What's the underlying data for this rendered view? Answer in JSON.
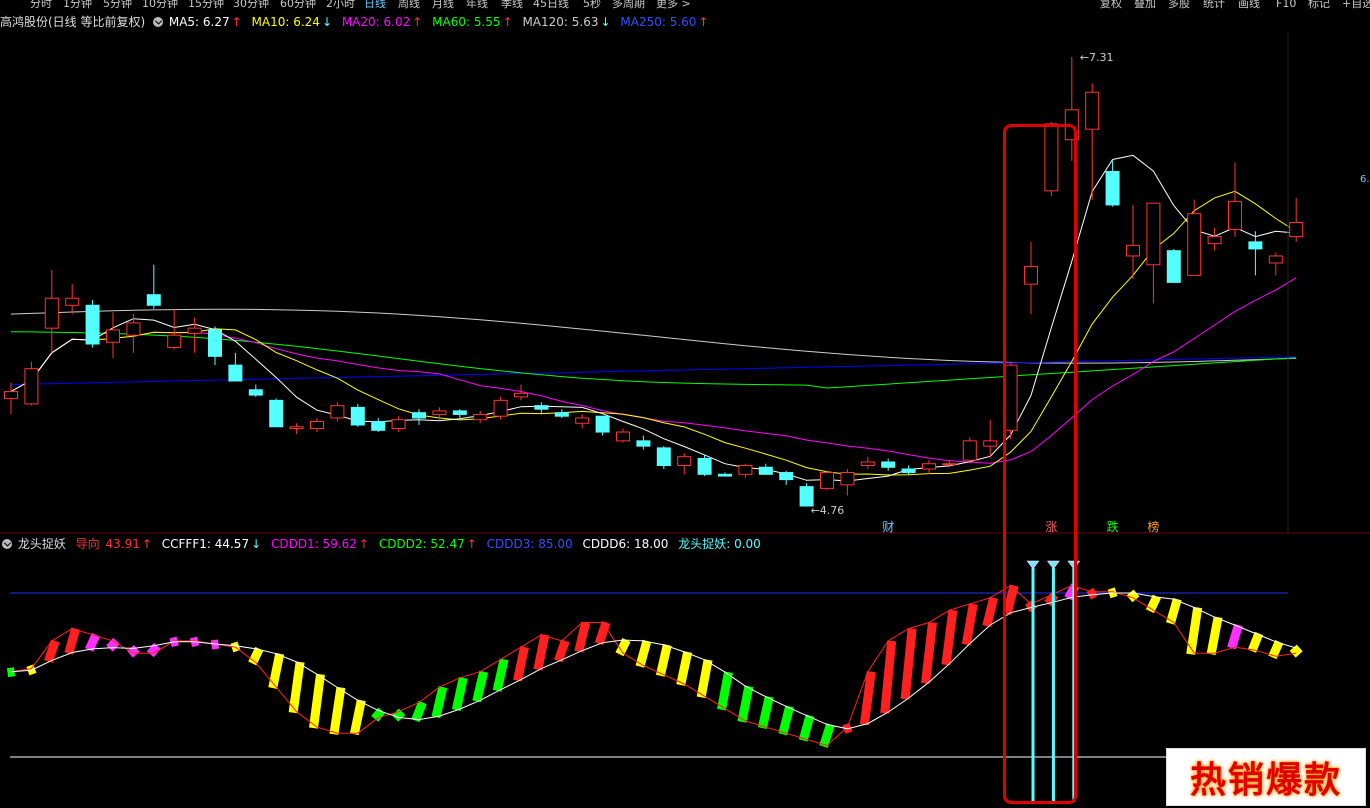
{
  "toolbar": {
    "timeframes": [
      "分时",
      "1分钟",
      "5分钟",
      "10分钟",
      "15分钟",
      "30分钟",
      "60分钟",
      "2小时",
      "日线",
      "周线",
      "月线",
      "年线",
      "季线",
      "45日线",
      "5秒",
      "多周期",
      "更多 >"
    ],
    "active_timeframe": "日线",
    "right_actions": [
      "复权",
      "叠加",
      "多股",
      "统计",
      "画线",
      "F10",
      "标记",
      "+自选"
    ]
  },
  "main_header": {
    "stock_label": "高鸿股份(日线 等比前复权)",
    "ma5": "MA5: 6.27",
    "ma10": "MA10: 6.24",
    "ma20": "MA20: 6.02",
    "ma60": "MA60: 5.55",
    "ma120": "MA120: 5.63",
    "ma250": "MA250: 5.60",
    "ma5_trend": "↑",
    "ma10_trend": "↓",
    "ma20_trend": "↑",
    "ma60_trend": "↑",
    "ma120_trend": "↓",
    "ma250_trend": "↑"
  },
  "price_labels": {
    "high": "7.31",
    "low": "4.76",
    "right_edge": "6."
  },
  "event_markers": {
    "cai": "财",
    "zhang": "涨",
    "die": "跌",
    "bang": "榜"
  },
  "indicator_header": {
    "name": "龙头捉妖",
    "daoxiang": "导向",
    "daoxiang_val": "43.91",
    "ccfff1": "CCFFF1: 44.57",
    "cddd1": "CDDD1: 59.62",
    "cddd2": "CDDD2: 52.47",
    "cddd3": "CDDD3: 85.00",
    "cddd6": "CDDD6: 18.00",
    "ltzy": "龙头捉妖: 0.00",
    "daoxiang_trend": "↑",
    "ccfff1_trend": "↓",
    "cddd1_trend": "↑",
    "cddd2_trend": "↑"
  },
  "watermark": {
    "text": "热销爆款"
  },
  "colors": {
    "up": "#ff3232",
    "down": "#54ffff",
    "ma5": "#ffffff",
    "ma10": "#ffff00",
    "ma20": "#ff00ff",
    "ma60": "#00ff00",
    "ma120": "#cccccc",
    "ma250": "#0000ff",
    "highlight_box": "#e00000"
  },
  "candles": [
    {
      "o": 5.37,
      "c": 5.41,
      "h": 5.46,
      "l": 5.28
    },
    {
      "o": 5.34,
      "c": 5.54,
      "h": 5.58,
      "l": 5.33
    },
    {
      "o": 5.77,
      "c": 5.94,
      "h": 6.1,
      "l": 5.63
    },
    {
      "o": 5.9,
      "c": 5.94,
      "h": 6.02,
      "l": 5.85
    },
    {
      "o": 5.9,
      "c": 5.68,
      "h": 5.93,
      "l": 5.66
    },
    {
      "o": 5.69,
      "c": 5.76,
      "h": 5.86,
      "l": 5.6
    },
    {
      "o": 5.73,
      "c": 5.8,
      "h": 5.85,
      "l": 5.63
    },
    {
      "o": 5.96,
      "c": 5.9,
      "h": 6.13,
      "l": 5.88
    },
    {
      "o": 5.66,
      "c": 5.73,
      "h": 5.88,
      "l": 5.65
    },
    {
      "o": 5.74,
      "c": 5.77,
      "h": 5.83,
      "l": 5.63
    },
    {
      "o": 5.76,
      "c": 5.61,
      "h": 5.78,
      "l": 5.56
    },
    {
      "o": 5.56,
      "c": 5.47,
      "h": 5.63,
      "l": 5.47
    },
    {
      "o": 5.42,
      "c": 5.39,
      "h": 5.45,
      "l": 5.38
    },
    {
      "o": 5.36,
      "c": 5.21,
      "h": 5.37,
      "l": 5.21
    },
    {
      "o": 5.2,
      "c": 5.21,
      "h": 5.23,
      "l": 5.17
    },
    {
      "o": 5.2,
      "c": 5.24,
      "h": 5.26,
      "l": 5.18
    },
    {
      "o": 5.26,
      "c": 5.33,
      "h": 5.35,
      "l": 5.24
    },
    {
      "o": 5.32,
      "c": 5.22,
      "h": 5.34,
      "l": 5.21
    },
    {
      "o": 5.24,
      "c": 5.19,
      "h": 5.26,
      "l": 5.18
    },
    {
      "o": 5.2,
      "c": 5.25,
      "h": 5.27,
      "l": 5.18
    },
    {
      "o": 5.29,
      "c": 5.26,
      "h": 5.31,
      "l": 5.22
    },
    {
      "o": 5.28,
      "c": 5.3,
      "h": 5.32,
      "l": 5.25
    },
    {
      "o": 5.3,
      "c": 5.28,
      "h": 5.31,
      "l": 5.26
    },
    {
      "o": 5.25,
      "c": 5.28,
      "h": 5.3,
      "l": 5.23
    },
    {
      "o": 5.27,
      "c": 5.36,
      "h": 5.38,
      "l": 5.25
    },
    {
      "o": 5.38,
      "c": 5.4,
      "h": 5.45,
      "l": 5.36
    },
    {
      "o": 5.33,
      "c": 5.31,
      "h": 5.35,
      "l": 5.28
    },
    {
      "o": 5.29,
      "c": 5.27,
      "h": 5.31,
      "l": 5.26
    },
    {
      "o": 5.23,
      "c": 5.26,
      "h": 5.28,
      "l": 5.2
    },
    {
      "o": 5.27,
      "c": 5.18,
      "h": 5.27,
      "l": 5.16
    },
    {
      "o": 5.13,
      "c": 5.18,
      "h": 5.2,
      "l": 5.12
    },
    {
      "o": 5.13,
      "c": 5.1,
      "h": 5.16,
      "l": 5.08
    },
    {
      "o": 5.09,
      "c": 4.99,
      "h": 5.1,
      "l": 4.97
    },
    {
      "o": 4.99,
      "c": 5.04,
      "h": 5.06,
      "l": 4.94
    },
    {
      "o": 5.03,
      "c": 4.94,
      "h": 5.05,
      "l": 4.93
    },
    {
      "o": 4.94,
      "c": 4.93,
      "h": 4.95,
      "l": 4.93
    },
    {
      "o": 4.94,
      "c": 4.99,
      "h": 5.0,
      "l": 4.92
    },
    {
      "o": 4.98,
      "c": 4.94,
      "h": 5.0,
      "l": 4.94
    },
    {
      "o": 4.95,
      "c": 4.91,
      "h": 4.96,
      "l": 4.88
    },
    {
      "o": 4.87,
      "c": 4.76,
      "h": 4.89,
      "l": 4.76
    },
    {
      "o": 4.86,
      "c": 4.95,
      "h": 4.96,
      "l": 4.85
    },
    {
      "o": 4.88,
      "c": 4.95,
      "h": 4.97,
      "l": 4.82
    },
    {
      "o": 4.99,
      "c": 5.01,
      "h": 5.04,
      "l": 4.97
    },
    {
      "o": 5.01,
      "c": 4.98,
      "h": 5.03,
      "l": 4.96
    },
    {
      "o": 4.97,
      "c": 4.95,
      "h": 4.99,
      "l": 4.94
    },
    {
      "o": 4.97,
      "c": 5.0,
      "h": 5.02,
      "l": 4.94
    },
    {
      "o": 5.0,
      "c": 5.0,
      "h": 5.02,
      "l": 4.98
    },
    {
      "o": 5.02,
      "c": 5.13,
      "h": 5.15,
      "l": 5.0
    },
    {
      "o": 5.1,
      "c": 5.13,
      "h": 5.25,
      "l": 5.03
    },
    {
      "o": 5.19,
      "c": 5.56,
      "h": 5.57,
      "l": 5.14
    },
    {
      "o": 6.02,
      "c": 6.12,
      "h": 6.26,
      "l": 5.85
    },
    {
      "o": 6.55,
      "c": 6.93,
      "h": 6.94,
      "l": 6.52
    },
    {
      "o": 6.84,
      "c": 7.01,
      "h": 7.31,
      "l": 6.72
    },
    {
      "o": 6.9,
      "c": 7.11,
      "h": 7.16,
      "l": 6.5
    },
    {
      "o": 6.66,
      "c": 6.47,
      "h": 6.73,
      "l": 6.46
    },
    {
      "o": 6.18,
      "c": 6.24,
      "h": 6.47,
      "l": 6.05
    },
    {
      "o": 6.13,
      "c": 6.48,
      "h": 6.48,
      "l": 5.91
    },
    {
      "o": 6.21,
      "c": 6.03,
      "h": 6.22,
      "l": 6.03
    },
    {
      "o": 6.07,
      "c": 6.42,
      "h": 6.5,
      "l": 6.07
    },
    {
      "o": 6.25,
      "c": 6.29,
      "h": 6.34,
      "l": 6.21
    },
    {
      "o": 6.33,
      "c": 6.49,
      "h": 6.71,
      "l": 6.29
    },
    {
      "o": 6.26,
      "c": 6.22,
      "h": 6.32,
      "l": 6.07
    },
    {
      "o": 6.14,
      "c": 6.18,
      "h": 6.2,
      "l": 6.07
    },
    {
      "o": 6.29,
      "c": 6.37,
      "h": 6.51,
      "l": 6.26
    }
  ],
  "indicator_bars": [
    {
      "v": 60,
      "c": "g"
    },
    {
      "v": 61,
      "c": "y"
    },
    {
      "v": 70,
      "c": "r"
    },
    {
      "v": 74,
      "c": "r"
    },
    {
      "v": 72,
      "c": "m"
    },
    {
      "v": 70,
      "c": "m"
    },
    {
      "v": 66,
      "c": "m"
    },
    {
      "v": 66,
      "c": "m"
    },
    {
      "v": 70,
      "c": "m"
    },
    {
      "v": 70,
      "c": "m"
    },
    {
      "v": 69,
      "c": "m"
    },
    {
      "v": 68,
      "c": "y"
    },
    {
      "v": 63,
      "c": "y"
    },
    {
      "v": 55,
      "c": "y"
    },
    {
      "v": 47,
      "c": "y"
    },
    {
      "v": 42,
      "c": "y"
    },
    {
      "v": 40,
      "c": "y"
    },
    {
      "v": 40,
      "c": "y"
    },
    {
      "v": 45,
      "c": "g"
    },
    {
      "v": 47,
      "c": "g"
    },
    {
      "v": 50,
      "c": "g"
    },
    {
      "v": 55,
      "c": "g"
    },
    {
      "v": 58,
      "c": "g"
    },
    {
      "v": 60,
      "c": "g"
    },
    {
      "v": 64,
      "c": "g"
    },
    {
      "v": 68,
      "c": "r"
    },
    {
      "v": 72,
      "c": "r"
    },
    {
      "v": 70,
      "c": "r"
    },
    {
      "v": 76,
      "c": "r"
    },
    {
      "v": 76,
      "c": "r"
    },
    {
      "v": 66,
      "c": "y"
    },
    {
      "v": 62,
      "c": "y"
    },
    {
      "v": 59,
      "c": "y"
    },
    {
      "v": 56,
      "c": "y"
    },
    {
      "v": 52,
      "c": "y"
    },
    {
      "v": 48,
      "c": "g"
    },
    {
      "v": 44,
      "c": "g"
    },
    {
      "v": 42,
      "c": "g"
    },
    {
      "v": 40,
      "c": "g"
    },
    {
      "v": 38,
      "c": "g"
    },
    {
      "v": 36,
      "c": "g"
    },
    {
      "v": 42,
      "c": "r"
    },
    {
      "v": 60,
      "c": "r"
    },
    {
      "v": 70,
      "c": "r"
    },
    {
      "v": 74,
      "c": "r"
    },
    {
      "v": 76,
      "c": "r"
    },
    {
      "v": 80,
      "c": "r"
    },
    {
      "v": 82,
      "c": "r"
    },
    {
      "v": 84,
      "c": "r"
    },
    {
      "v": 88,
      "c": "r"
    },
    {
      "v": 82,
      "c": "r"
    },
    {
      "v": 85,
      "c": "r"
    },
    {
      "v": 88,
      "c": "m"
    },
    {
      "v": 86,
      "c": "r"
    },
    {
      "v": 86,
      "c": "y"
    },
    {
      "v": 84,
      "c": "y"
    },
    {
      "v": 80,
      "c": "y"
    },
    {
      "v": 76,
      "c": "y"
    },
    {
      "v": 66,
      "c": "y"
    },
    {
      "v": 66,
      "c": "y"
    },
    {
      "v": 68,
      "c": "m"
    },
    {
      "v": 67,
      "c": "y"
    },
    {
      "v": 65,
      "c": "y"
    },
    {
      "v": 66,
      "c": "y"
    }
  ]
}
